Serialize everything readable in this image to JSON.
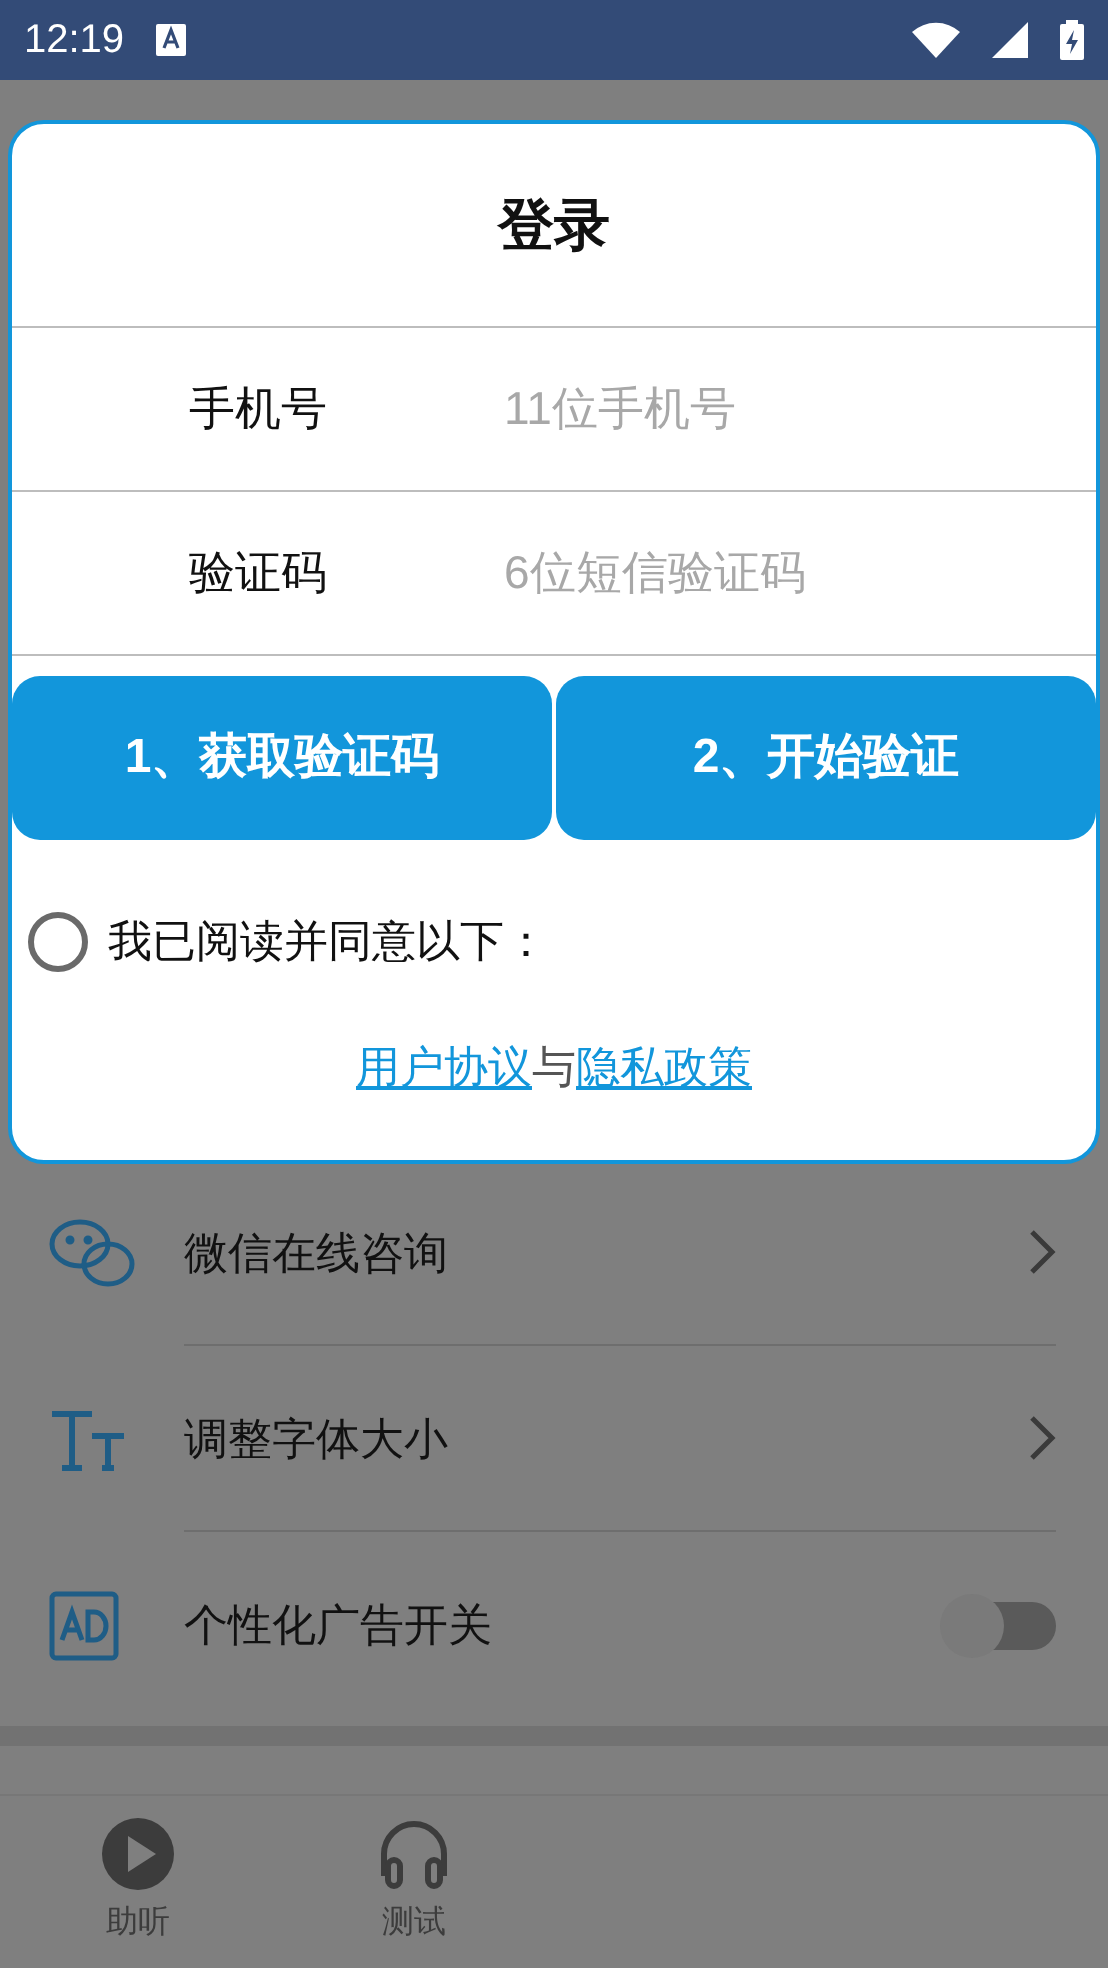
{
  "status_bar": {
    "time": "12:19"
  },
  "login_dialog": {
    "title": "登录",
    "fields": [
      {
        "label": "手机号",
        "placeholder": "11位手机号"
      },
      {
        "label": "验证码",
        "placeholder": "6位短信验证码"
      }
    ],
    "buttons": [
      "1、获取验证码",
      "2、开始验证"
    ],
    "agreement": {
      "checked": false,
      "text": "我已阅读并同意以下：",
      "link_1": "用户协议",
      "joiner": "与",
      "link_2": "隐私政策"
    }
  },
  "settings": [
    {
      "kind": "chat",
      "label": "微信在线咨询"
    },
    {
      "kind": "font",
      "label": "调整字体大小"
    },
    {
      "kind": "ad",
      "label": "个性化广告开关",
      "on": false
    }
  ],
  "bottom_nav": [
    {
      "kind": "play",
      "label": "助听"
    },
    {
      "kind": "headphones",
      "label": "测试"
    }
  ]
}
